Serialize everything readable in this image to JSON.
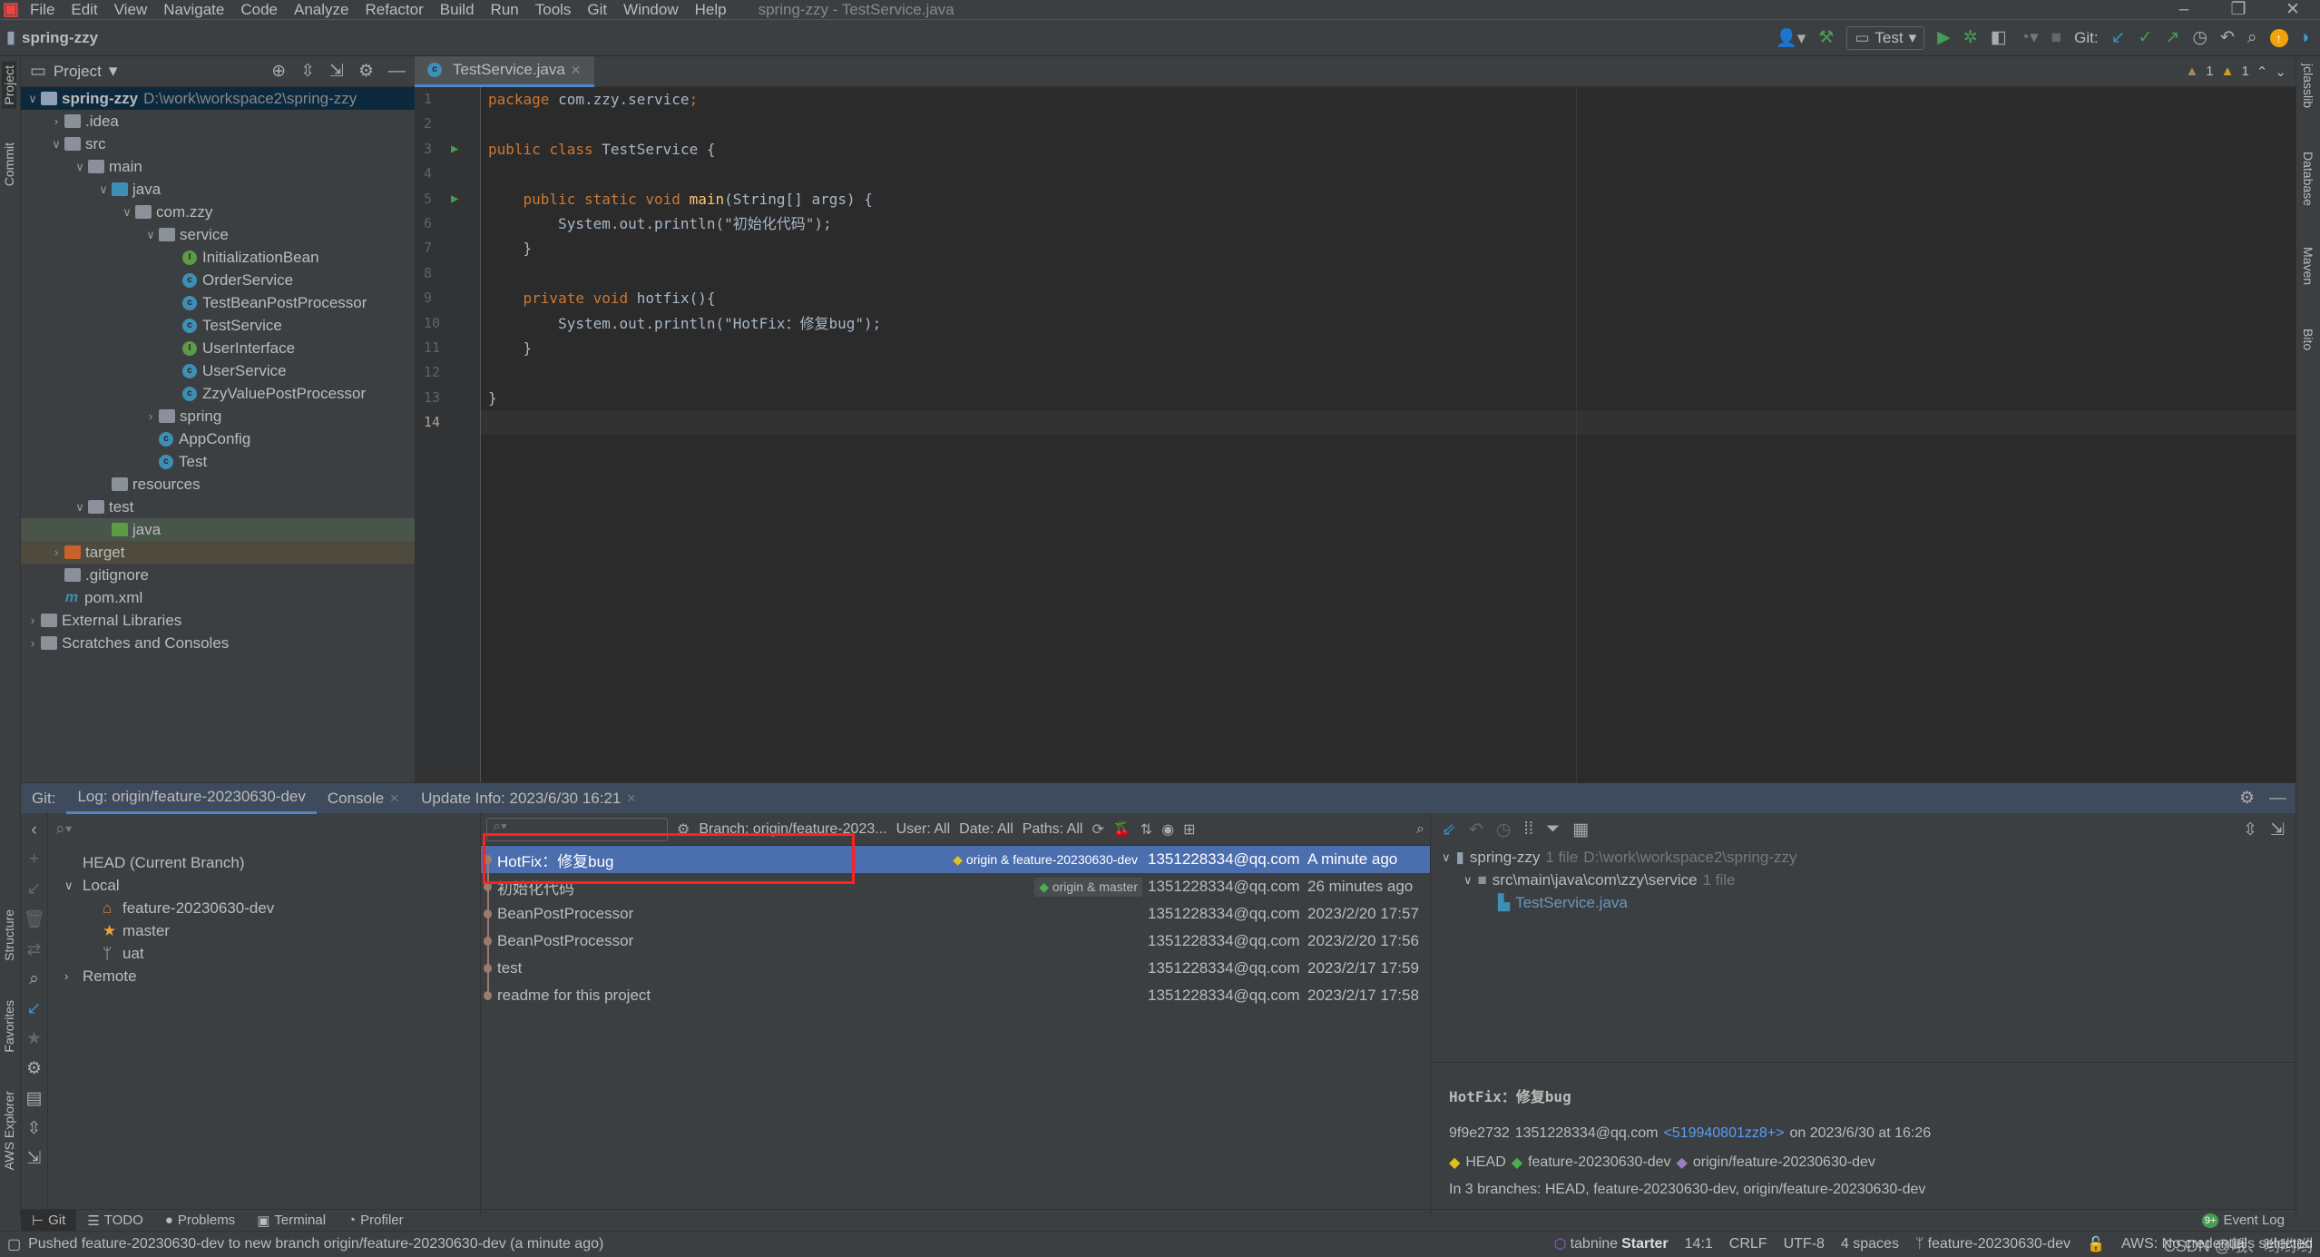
{
  "menu": {
    "items": [
      "File",
      "Edit",
      "View",
      "Navigate",
      "Code",
      "Analyze",
      "Refactor",
      "Build",
      "Run",
      "Tools",
      "Git",
      "Window",
      "Help"
    ],
    "window_title": "spring-zzy - TestService.java"
  },
  "titlebar": {
    "project": "spring-zzy",
    "run_config": "Test",
    "git_label": "Git:"
  },
  "left_stripe": {
    "project": "Project",
    "commit": "Commit",
    "structure": "Structure",
    "favorites": "Favorites",
    "aws": "AWS Explorer"
  },
  "right_stripe": {
    "jclasslib": "jclasslib",
    "database": "Database",
    "maven": "Maven",
    "bito": "Bito"
  },
  "project_panel": {
    "title": "Project",
    "tree": [
      {
        "label": "spring-zzy",
        "hint": "D:\\work\\workspace2\\spring-zzy",
        "depth": 0,
        "arrow": "down",
        "icon": "module",
        "bold": true
      },
      {
        "label": ".idea",
        "depth": 1,
        "arrow": "right",
        "icon": "folder"
      },
      {
        "label": "src",
        "depth": 1,
        "arrow": "down",
        "icon": "folder"
      },
      {
        "label": "main",
        "depth": 2,
        "arrow": "down",
        "icon": "folder"
      },
      {
        "label": "java",
        "depth": 3,
        "arrow": "down",
        "icon": "source-folder"
      },
      {
        "label": "com.zzy",
        "depth": 4,
        "arrow": "down",
        "icon": "package"
      },
      {
        "label": "service",
        "depth": 5,
        "arrow": "down",
        "icon": "package"
      },
      {
        "label": "InitializationBean",
        "depth": 6,
        "icon": "interface"
      },
      {
        "label": "OrderService",
        "depth": 6,
        "icon": "class"
      },
      {
        "label": "TestBeanPostProcessor",
        "depth": 6,
        "icon": "class"
      },
      {
        "label": "TestService",
        "depth": 6,
        "icon": "class"
      },
      {
        "label": "UserInterface",
        "depth": 6,
        "icon": "interface"
      },
      {
        "label": "UserService",
        "depth": 6,
        "icon": "class"
      },
      {
        "label": "ZzyValuePostProcessor",
        "depth": 6,
        "icon": "class"
      },
      {
        "label": "spring",
        "depth": 5,
        "arrow": "right",
        "icon": "package"
      },
      {
        "label": "AppConfig",
        "depth": 5,
        "icon": "class"
      },
      {
        "label": "Test",
        "depth": 5,
        "icon": "class"
      },
      {
        "label": "resources",
        "depth": 3,
        "icon": "resources-folder"
      },
      {
        "label": "test",
        "depth": 2,
        "arrow": "down",
        "icon": "folder"
      },
      {
        "label": "java",
        "depth": 3,
        "icon": "test-folder",
        "highlight": "#49544a"
      },
      {
        "label": "target",
        "depth": 1,
        "arrow": "right",
        "icon": "excluded-folder",
        "highlight": "#4f4a3e"
      },
      {
        "label": ".gitignore",
        "depth": 1,
        "icon": "gitignore-file"
      },
      {
        "label": "pom.xml",
        "depth": 1,
        "icon": "maven-file"
      },
      {
        "label": "External Libraries",
        "depth": 0,
        "arrow": "right",
        "icon": "libraries"
      },
      {
        "label": "Scratches and Consoles",
        "depth": 0,
        "arrow": "right",
        "icon": "scratches"
      }
    ]
  },
  "editor": {
    "tab": "TestService.java",
    "warnings": "1",
    "weak_warnings": "1",
    "cursor_line": 14,
    "lines": [
      "package com.zzy.service;",
      "",
      "public class TestService {",
      "",
      "    public static void main(String[] args) {",
      "        System.out.println(\"初始化代码\");",
      "    }",
      "",
      "    private void hotfix(){",
      "        System.out.println(\"HotFix：修复bug\");",
      "    }",
      "",
      "}",
      ""
    ]
  },
  "git_panel": {
    "label": "Git:",
    "tabs": [
      "Log: origin/feature-20230630-dev",
      "Console",
      "Update Info: 2023/6/30 16:21"
    ],
    "branches": {
      "head": "HEAD (Current Branch)",
      "local": "Local",
      "local_items": [
        "feature-20230630-dev",
        "master",
        "uat"
      ],
      "remote": "Remote"
    },
    "filters": {
      "branch": "Branch: origin/feature-2023...",
      "user": "User: All",
      "date": "Date: All",
      "paths": "Paths: All"
    },
    "commits": [
      {
        "msg": "HotFix：修复bug",
        "tags": "origin & feature-20230630-dev",
        "author": "1351228334@qq.com",
        "date": "A minute ago",
        "selected": true
      },
      {
        "msg": "初始化代码",
        "tags": "origin & master",
        "author": "1351228334@qq.com",
        "date": "26 minutes ago"
      },
      {
        "msg": "BeanPostProcessor",
        "author": "1351228334@qq.com",
        "date": "2023/2/20 17:57"
      },
      {
        "msg": "BeanPostProcessor",
        "author": "1351228334@qq.com",
        "date": "2023/2/20 17:56"
      },
      {
        "msg": "test",
        "author": "1351228334@qq.com",
        "date": "2023/2/17 17:59"
      },
      {
        "msg": "readme for this project",
        "author": "1351228334@qq.com",
        "date": "2023/2/17 17:58"
      }
    ],
    "changes": {
      "root": "spring-zzy",
      "root_count": "1 file",
      "root_path": "D:\\work\\workspace2\\spring-zzy",
      "dir": "src\\main\\java\\com\\zzy\\service",
      "dir_count": "1 file",
      "file": "TestService.java"
    },
    "detail": {
      "title": "HotFix：修复bug",
      "hash": "9f9e2732",
      "author": "1351228334@qq.com",
      "committer": "<519940801zz8+>",
      "on": "on 2023/6/30 at 16:26",
      "refs": [
        "HEAD",
        "feature-20230630-dev",
        "origin/feature-20230630-dev"
      ],
      "branches": "In 3 branches: HEAD, feature-20230630-dev, origin/feature-20230630-dev"
    }
  },
  "tool_windows": [
    "Git",
    "TODO",
    "Problems",
    "Terminal",
    "Profiler"
  ],
  "event_log": {
    "badge": "9+",
    "label": "Event Log"
  },
  "status": {
    "message": "Pushed feature-20230630-dev to new branch origin/feature-20230630-dev (a minute ago)",
    "tabnine": "tabnine",
    "tabnine_plan": "Starter",
    "position": "14:1",
    "line_sep": "CRLF",
    "encoding": "UTF-8",
    "indent": "4 spaces",
    "branch": "feature-20230630-dev",
    "aws": "AWS: No credentials selected",
    "watermark": "CSDN @哦、哟哟哟"
  },
  "colors": {
    "accent": "#4a88c7",
    "selection": "#4b6eaf",
    "highlight_box": "#ff2020",
    "run_green": "#499c54"
  }
}
